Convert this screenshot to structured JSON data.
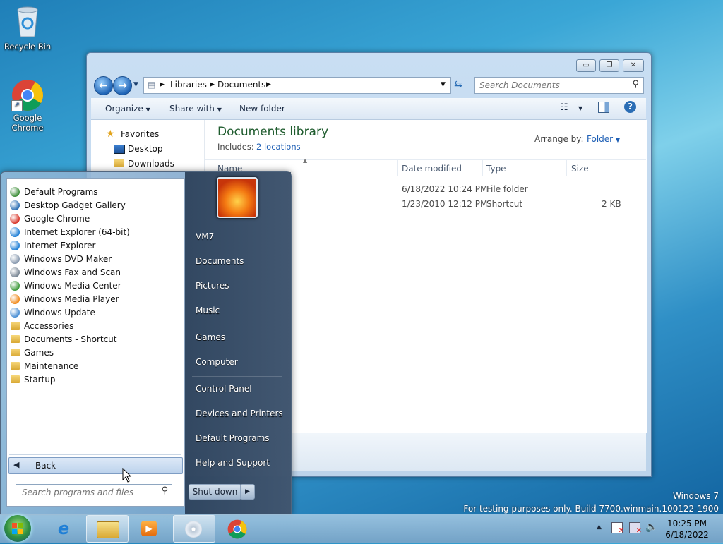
{
  "desktop": {
    "icons": [
      {
        "label": "Recycle Bin",
        "icon": "recycle-bin-icon"
      },
      {
        "label": "Google Chrome",
        "icon": "chrome-icon"
      }
    ],
    "watermark_line1": "Windows 7",
    "watermark_line2": "For testing purposes only. Build 7700.winmain.100122-1900"
  },
  "explorer": {
    "caption_buttons": {
      "minimize": "▭",
      "maximize": "❐",
      "close": "✕"
    },
    "breadcrumb": [
      "Libraries",
      "Documents"
    ],
    "search_placeholder": "Search Documents",
    "toolbar": {
      "organize": "Organize",
      "share_with": "Share with",
      "new_folder": "New folder"
    },
    "nav_pane": {
      "favorites": "Favorites",
      "items": [
        "Desktop",
        "Downloads"
      ]
    },
    "library_title": "Documents library",
    "includes_label": "Includes:",
    "includes_link": "2 locations",
    "arrange_by_label": "Arrange by:",
    "arrange_by_value": "Folder",
    "columns": [
      "Name",
      "Date modified",
      "Type",
      "Size"
    ],
    "rows": [
      {
        "date": "6/18/2022 10:24 PM",
        "type": "File folder",
        "size": ""
      },
      {
        "date": "1/23/2010 12:12 PM",
        "type": "Shortcut",
        "size": "2 KB"
      }
    ]
  },
  "start_menu": {
    "programs": [
      {
        "label": "Default Programs",
        "icon": "default-programs-icon",
        "kind": "app",
        "color": "#3f8f3a"
      },
      {
        "label": "Desktop Gadget Gallery",
        "icon": "gadget-gallery-icon",
        "kind": "app",
        "color": "#2d6fb4"
      },
      {
        "label": "Google Chrome",
        "icon": "chrome-icon",
        "kind": "app",
        "color": "#d9382b"
      },
      {
        "label": "Internet Explorer (64-bit)",
        "icon": "internet-explorer-icon",
        "kind": "app",
        "color": "#1f7fd6"
      },
      {
        "label": "Internet Explorer",
        "icon": "internet-explorer-icon",
        "kind": "app",
        "color": "#1f7fd6"
      },
      {
        "label": "Windows DVD Maker",
        "icon": "dvd-maker-icon",
        "kind": "app",
        "color": "#8a9bb0"
      },
      {
        "label": "Windows Fax and Scan",
        "icon": "fax-scan-icon",
        "kind": "app",
        "color": "#7a8795"
      },
      {
        "label": "Windows Media Center",
        "icon": "media-center-icon",
        "kind": "app",
        "color": "#3d9a3a"
      },
      {
        "label": "Windows Media Player",
        "icon": "media-player-icon",
        "kind": "app",
        "color": "#f08a1c"
      },
      {
        "label": "Windows Update",
        "icon": "windows-update-icon",
        "kind": "app",
        "color": "#4a8fd4"
      },
      {
        "label": "Accessories",
        "icon": "folder-icon",
        "kind": "folder"
      },
      {
        "label": "Documents - Shortcut",
        "icon": "folder-icon",
        "kind": "folder"
      },
      {
        "label": "Games",
        "icon": "folder-icon",
        "kind": "folder"
      },
      {
        "label": "Maintenance",
        "icon": "folder-icon",
        "kind": "folder"
      },
      {
        "label": "Startup",
        "icon": "folder-icon",
        "kind": "folder"
      }
    ],
    "back_label": "Back",
    "search_placeholder": "Search programs and files",
    "right_items": {
      "user": "VM7",
      "documents": "Documents",
      "pictures": "Pictures",
      "music": "Music",
      "games": "Games",
      "computer": "Computer",
      "control_panel": "Control Panel",
      "devices_printers": "Devices and Printers",
      "default_programs": "Default Programs",
      "help_support": "Help and Support"
    },
    "shutdown_label": "Shut down"
  },
  "taskbar": {
    "clock_time": "10:25 PM",
    "clock_date": "6/18/2022",
    "pinned": [
      "start-orb",
      "internet-explorer-icon",
      "windows-explorer-icon",
      "media-player-icon",
      "dvd-maker-icon",
      "chrome-icon"
    ]
  }
}
